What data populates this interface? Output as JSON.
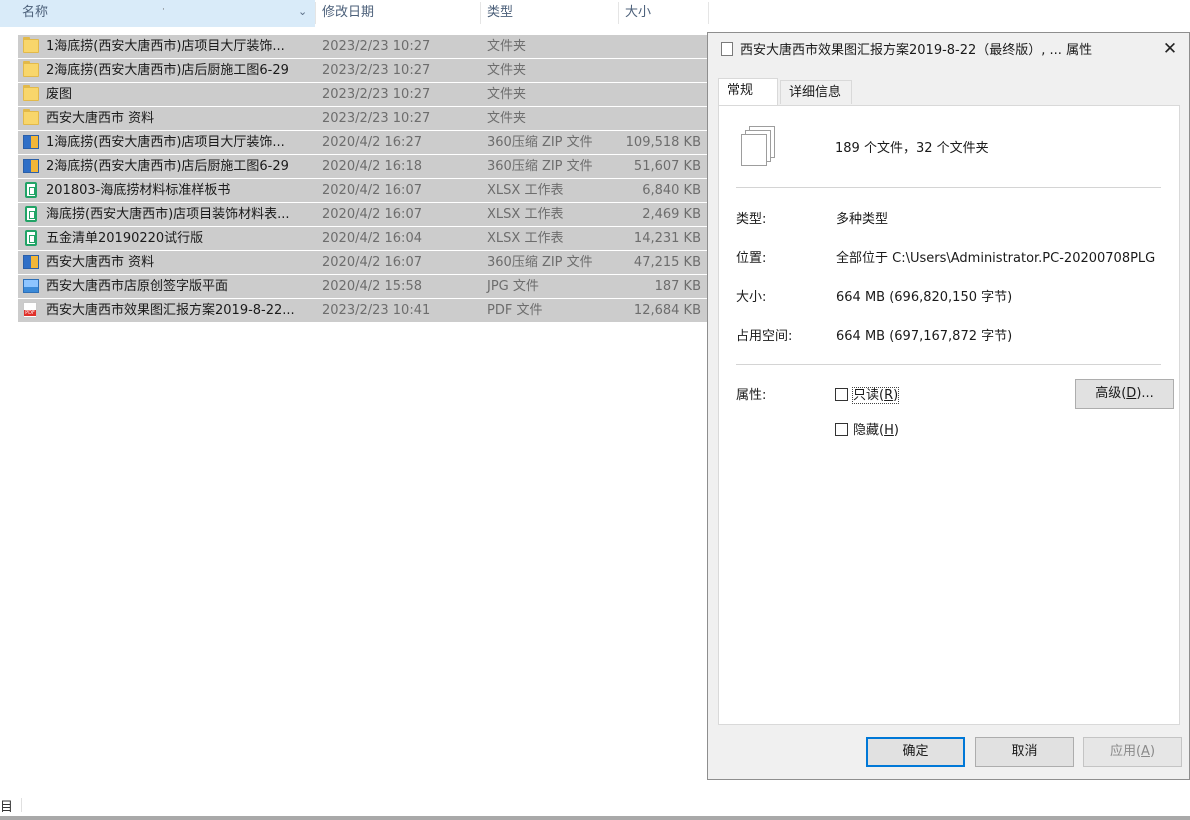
{
  "header": {
    "name": "名称",
    "date": "修改日期",
    "type": "类型",
    "size": "大小",
    "sort_icon": "chevron-down-icon"
  },
  "files": [
    {
      "icon": "folder-icon",
      "name": "1海底捞(西安大唐西市)店项目大厅装饰...",
      "date": "2023/2/23 10:27",
      "type": "文件夹",
      "size": ""
    },
    {
      "icon": "folder-icon",
      "name": "2海底捞(西安大唐西市)店后厨施工图6-29",
      "date": "2023/2/23 10:27",
      "type": "文件夹",
      "size": ""
    },
    {
      "icon": "folder-icon",
      "name": "废图",
      "date": "2023/2/23 10:27",
      "type": "文件夹",
      "size": ""
    },
    {
      "icon": "folder-icon",
      "name": "西安大唐西市 资料",
      "date": "2023/2/23 10:27",
      "type": "文件夹",
      "size": ""
    },
    {
      "icon": "zip-icon",
      "name": "1海底捞(西安大唐西市)店项目大厅装饰...",
      "date": "2020/4/2 16:27",
      "type": "360压缩 ZIP 文件",
      "size": "109,518 KB"
    },
    {
      "icon": "zip-icon",
      "name": "2海底捞(西安大唐西市)店后厨施工图6-29",
      "date": "2020/4/2 16:18",
      "type": "360压缩 ZIP 文件",
      "size": "51,607 KB"
    },
    {
      "icon": "xlsx-icon",
      "name": "201803-海底捞材料标准样板书",
      "date": "2020/4/2 16:07",
      "type": "XLSX 工作表",
      "size": "6,840 KB"
    },
    {
      "icon": "xlsx-icon",
      "name": "海底捞(西安大唐西市)店项目装饰材料表...",
      "date": "2020/4/2 16:07",
      "type": "XLSX 工作表",
      "size": "2,469 KB"
    },
    {
      "icon": "xlsx-icon",
      "name": "五金清单20190220试行版",
      "date": "2020/4/2 16:04",
      "type": "XLSX 工作表",
      "size": "14,231 KB"
    },
    {
      "icon": "zip-icon",
      "name": "西安大唐西市 资料",
      "date": "2020/4/2 16:07",
      "type": "360压缩 ZIP 文件",
      "size": "47,215 KB"
    },
    {
      "icon": "jpg-icon",
      "name": "西安大唐西市店原创签字版平面",
      "date": "2020/4/2 15:58",
      "type": "JPG 文件",
      "size": "187 KB"
    },
    {
      "icon": "pdf-icon",
      "name": "西安大唐西市效果图汇报方案2019-8-22...",
      "date": "2023/2/23 10:41",
      "type": "PDF 文件",
      "size": "12,684 KB"
    }
  ],
  "dialog": {
    "title": "西安大唐西市效果图汇报方案2019-8-22（最终版）, ... 属性",
    "close_icon": "close-icon",
    "tabs": [
      "常规",
      "详细信息"
    ],
    "summary": "189 个文件，32 个文件夹",
    "type_label": "类型:",
    "type_value": "多种类型",
    "location_label": "位置:",
    "location_value": "全部位于 C:\\Users\\Administrator.PC-20200708PLG",
    "size_label": "大小:",
    "size_value": "664 MB (696,820,150 字节)",
    "disk_label": "占用空间:",
    "disk_value": "664 MB (697,167,872 字节)",
    "attr_label": "属性:",
    "readonly_text": "只读(",
    "readonly_key": "R",
    "readonly_tail": ")",
    "hidden_text": "隐藏(",
    "hidden_key": "H",
    "hidden_tail": ")",
    "advanced_text": "高级(",
    "advanced_key": "D",
    "advanced_tail": ")...",
    "ok": "确定",
    "cancel": "取消",
    "apply_text": "应用(",
    "apply_key": "A",
    "apply_tail": ")"
  },
  "status": {
    "text": "目"
  }
}
